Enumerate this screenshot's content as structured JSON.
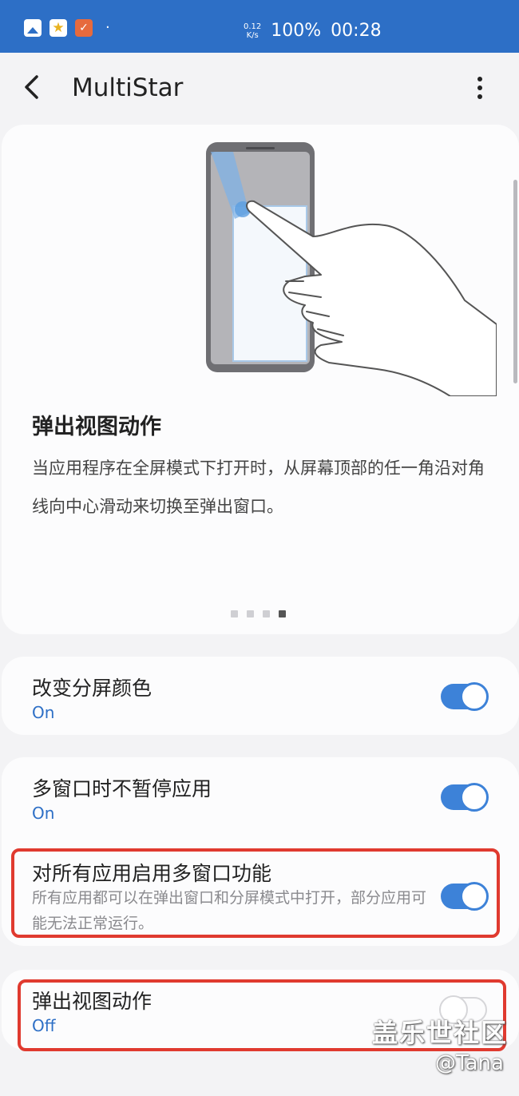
{
  "status_bar": {
    "icons": [
      "gallery-icon",
      "star-app-icon",
      "task-app-icon"
    ],
    "dot": "·",
    "speed_value": "0.12",
    "speed_unit": "K/s",
    "battery": "100%",
    "time": "00:28"
  },
  "header": {
    "back_icon": "‹",
    "title": "MultiStar"
  },
  "intro": {
    "title": "弹出视图动作",
    "description": "当应用程序在全屏模式下打开时，从屏幕顶部的任一角沿对角线向中心滑动来切换至弹出窗口。",
    "page_count": 4,
    "active_page": 4
  },
  "settings": [
    {
      "title": "改变分屏颜色",
      "status": "On",
      "enabled": true
    },
    {
      "title": "多窗口时不暂停应用",
      "status": "On",
      "enabled": true
    },
    {
      "title": "对所有应用启用多窗口功能",
      "description": "所有应用都可以在弹出窗口和分屏模式中打开，部分应用可能无法正常运行。",
      "enabled": true
    },
    {
      "title": "弹出视图动作",
      "status": "Off",
      "enabled": false
    }
  ],
  "watermark": {
    "main": "盖乐世社区",
    "sub": "@Tana"
  },
  "colors": {
    "status_bar": "#2d6fc6",
    "accent": "#3d82d8",
    "highlight": "#e03a2f"
  }
}
